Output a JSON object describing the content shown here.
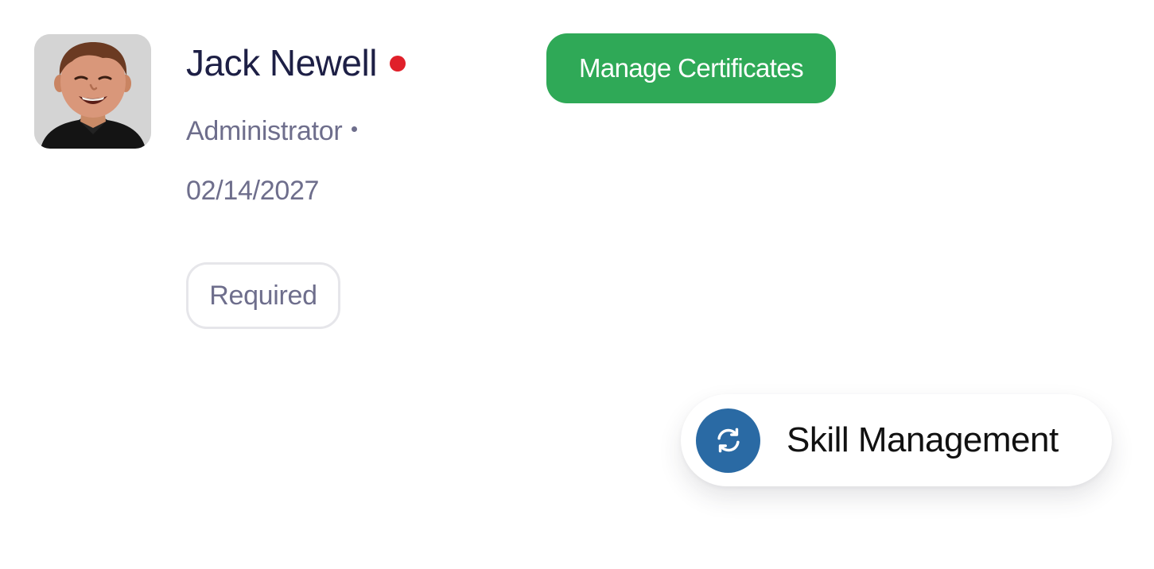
{
  "profile": {
    "name": "Jack Newell",
    "role": "Administrator",
    "date": "02/14/2027",
    "tag": "Required",
    "avatar_icon": "user-photo"
  },
  "actions": {
    "manage_certificates_label": "Manage Certificates"
  },
  "skill_card": {
    "label": "Skill Management",
    "icon": "refresh-icon"
  },
  "colors": {
    "status_dot": "#e0202a",
    "button_green": "#2fa957",
    "icon_blue": "#2a6aa4",
    "name_text": "#1d1f45",
    "muted_text": "#6e6e8c"
  }
}
